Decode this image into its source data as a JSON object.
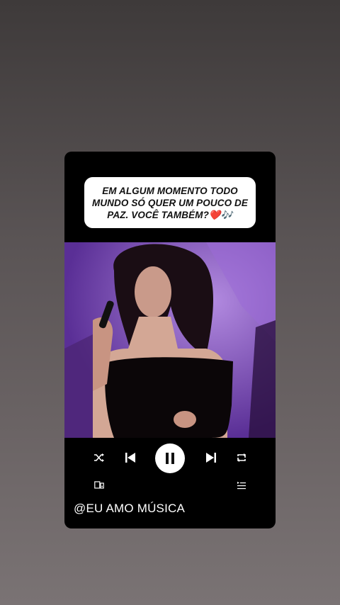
{
  "caption": {
    "text": "EM ALGUM MOMENTO TODO MUNDO SÓ QUER UM POUCO DE PAZ. VOCÊ TAMBÉM?❤️🎶"
  },
  "image": {
    "description_name": "singer-video-frame"
  },
  "player": {
    "shuffle_icon": "shuffle-icon",
    "prev_icon": "skip-previous-icon",
    "play_pause_icon": "pause-icon",
    "next_icon": "skip-next-icon",
    "repeat_icon": "repeat-icon",
    "devices_icon": "connect-devices-icon",
    "queue_icon": "queue-icon"
  },
  "footer": {
    "handle": "@EU AMO MÚSICA"
  },
  "colors": {
    "card_bg": "#000000",
    "caption_bg": "#ffffff",
    "photo_purple": "#7a48b8"
  }
}
